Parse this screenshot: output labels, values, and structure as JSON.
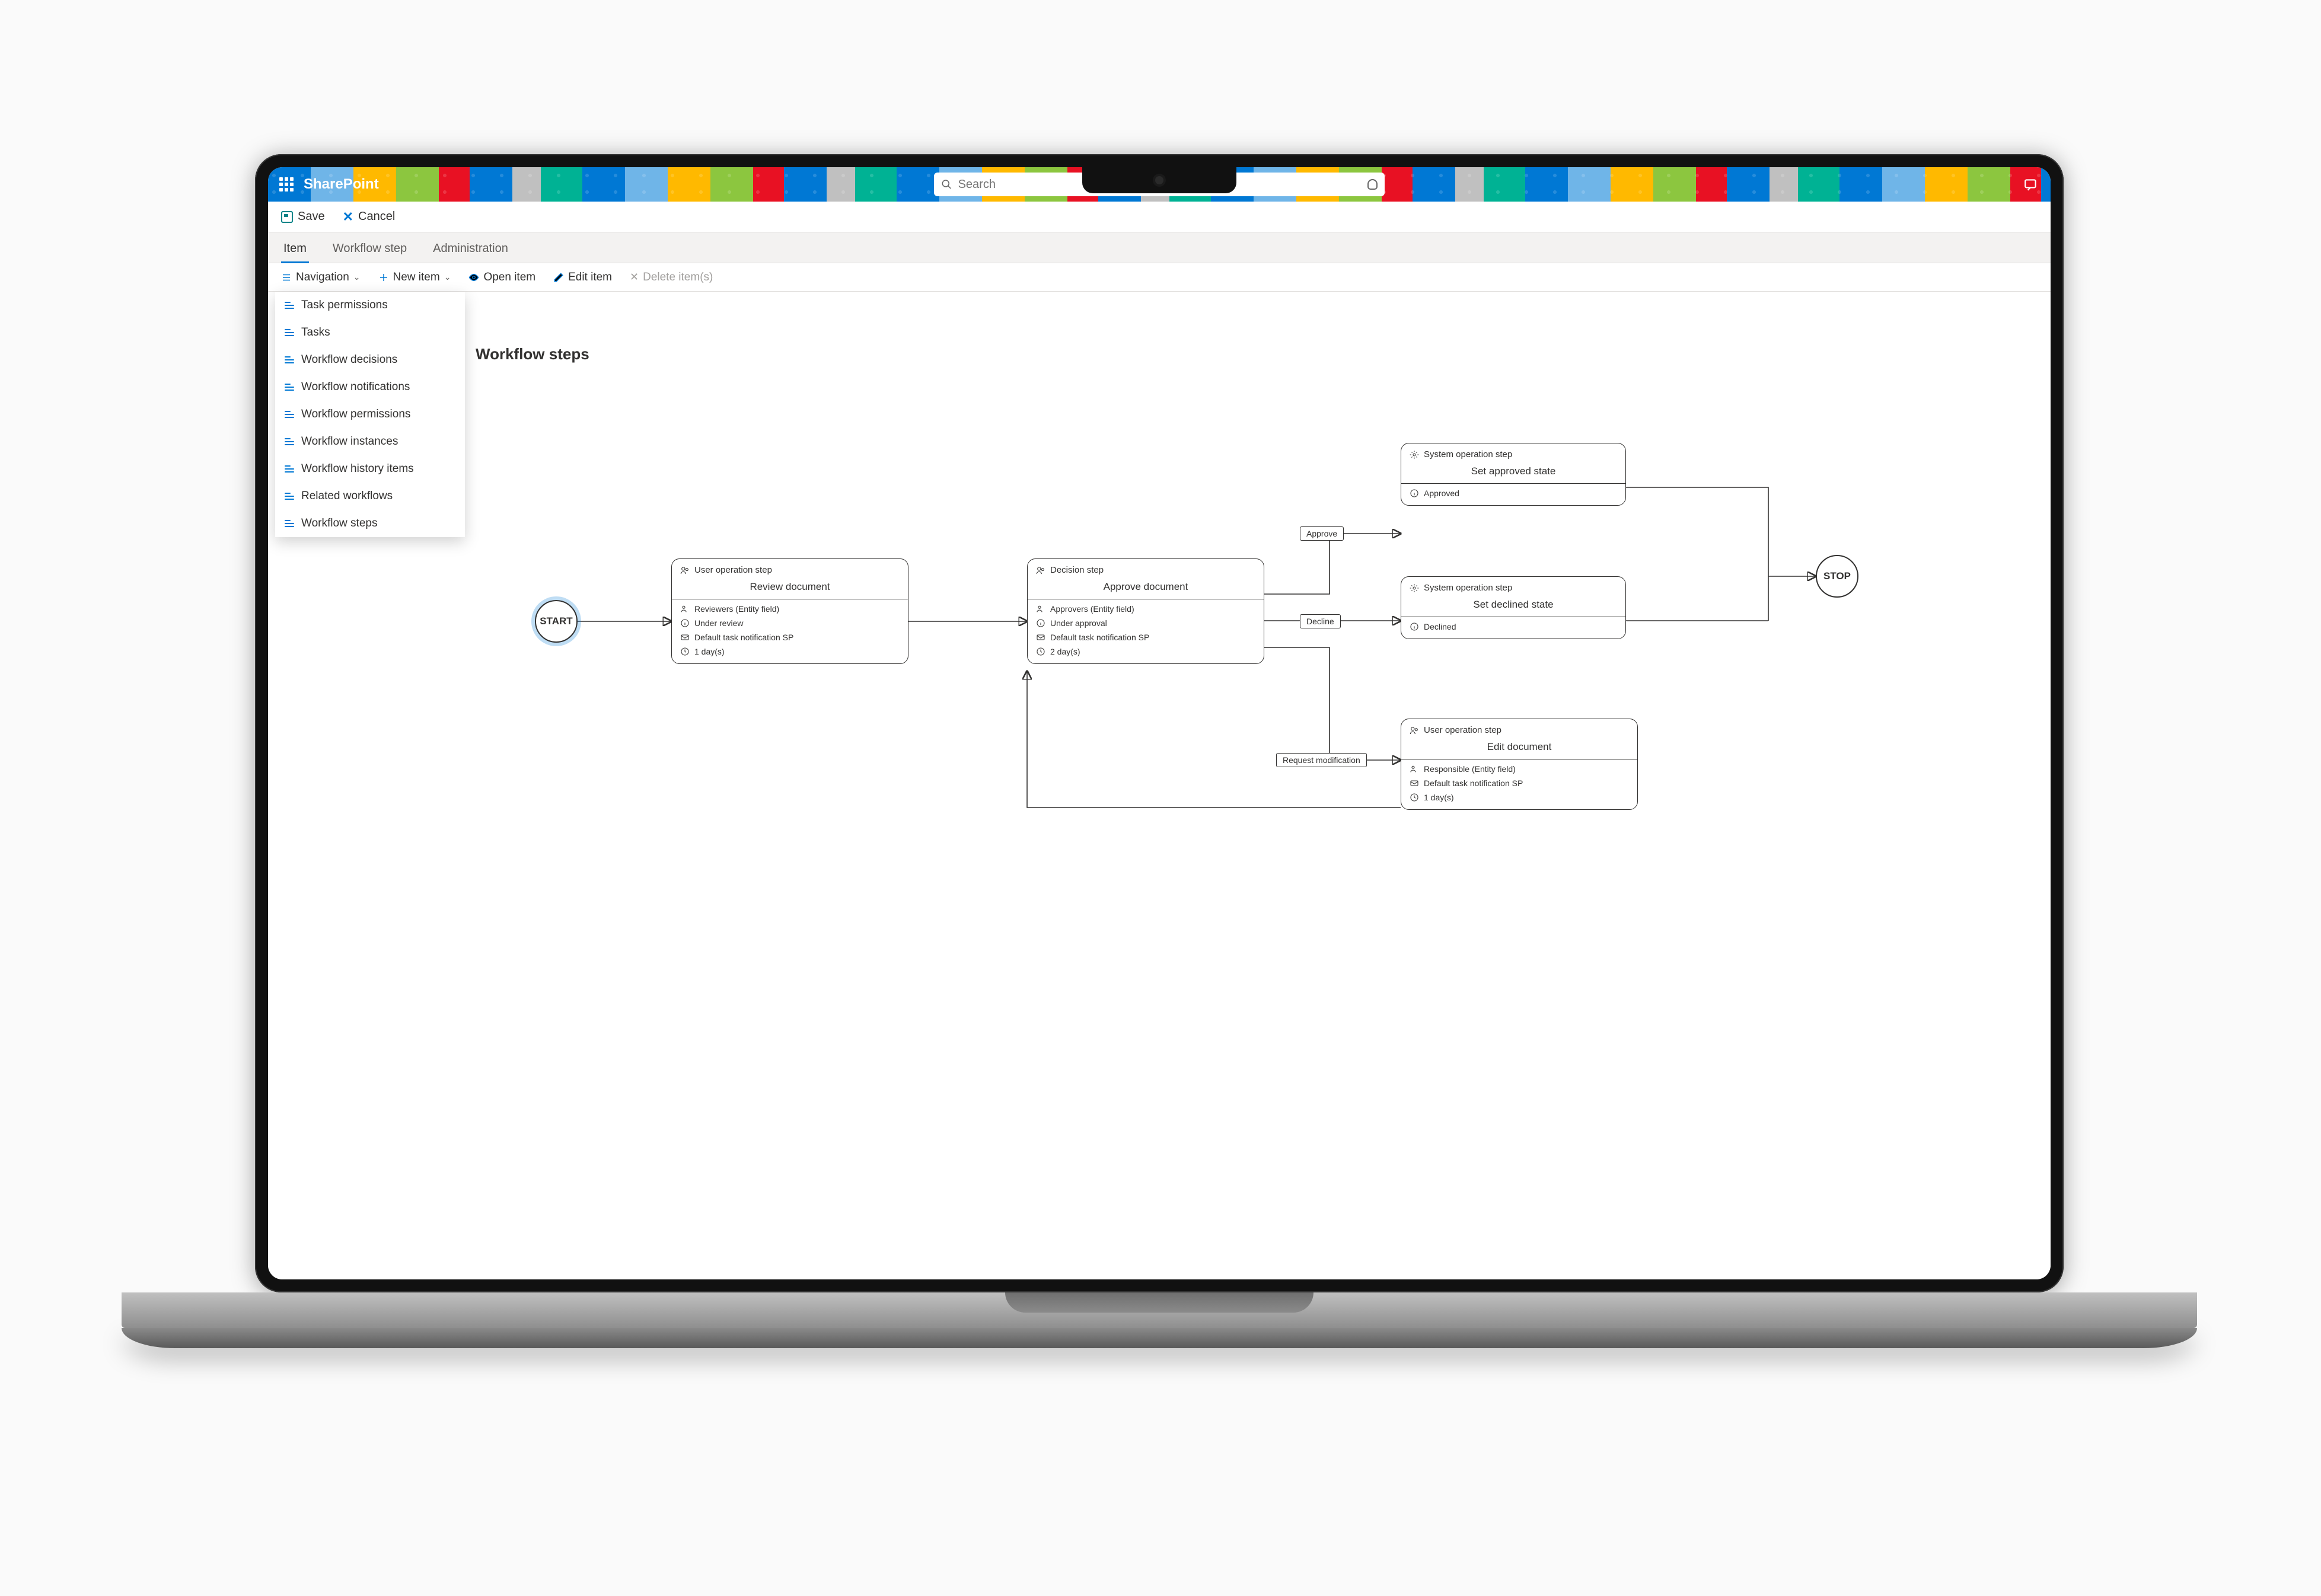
{
  "brand": "SharePoint",
  "search": {
    "placeholder": "Search"
  },
  "action_bar": {
    "save": "Save",
    "cancel": "Cancel"
  },
  "tabs": {
    "item": "Item",
    "workflow_step": "Workflow step",
    "administration": "Administration"
  },
  "cmdbar": {
    "navigation": "Navigation",
    "new_item": "New item",
    "open_item": "Open item",
    "edit_item": "Edit item",
    "delete_items": "Delete item(s)"
  },
  "nav_items": {
    "task_permissions": "Task permissions",
    "tasks": "Tasks",
    "workflow_decisions": "Workflow decisions",
    "workflow_notifications": "Workflow notifications",
    "workflow_permissions": "Workflow permissions",
    "workflow_instances": "Workflow instances",
    "workflow_history_items": "Workflow history items",
    "related_workflows": "Related workflows",
    "workflow_steps": "Workflow steps"
  },
  "page_title": "Workflow steps",
  "terminals": {
    "start": "START",
    "stop": "STOP"
  },
  "nodes": {
    "review": {
      "type": "User operation step",
      "title": "Review document",
      "actor": "Reviewers (Entity field)",
      "state": "Under review",
      "notification": "Default task notification SP",
      "duration": "1 day(s)"
    },
    "approve": {
      "type": "Decision step",
      "title": "Approve document",
      "actor": "Approvers (Entity field)",
      "state": "Under approval",
      "notification": "Default task notification SP",
      "duration": "2 day(s)"
    },
    "set_approved": {
      "type": "System operation step",
      "title": "Set approved state",
      "state": "Approved"
    },
    "set_declined": {
      "type": "System operation step",
      "title": "Set declined state",
      "state": "Declined"
    },
    "edit": {
      "type": "User operation step",
      "title": "Edit document",
      "actor": "Responsible (Entity field)",
      "notification": "Default task notification SP",
      "duration": "1 day(s)"
    }
  },
  "edges": {
    "approve": "Approve",
    "decline": "Decline",
    "request_modification": "Request modification"
  }
}
